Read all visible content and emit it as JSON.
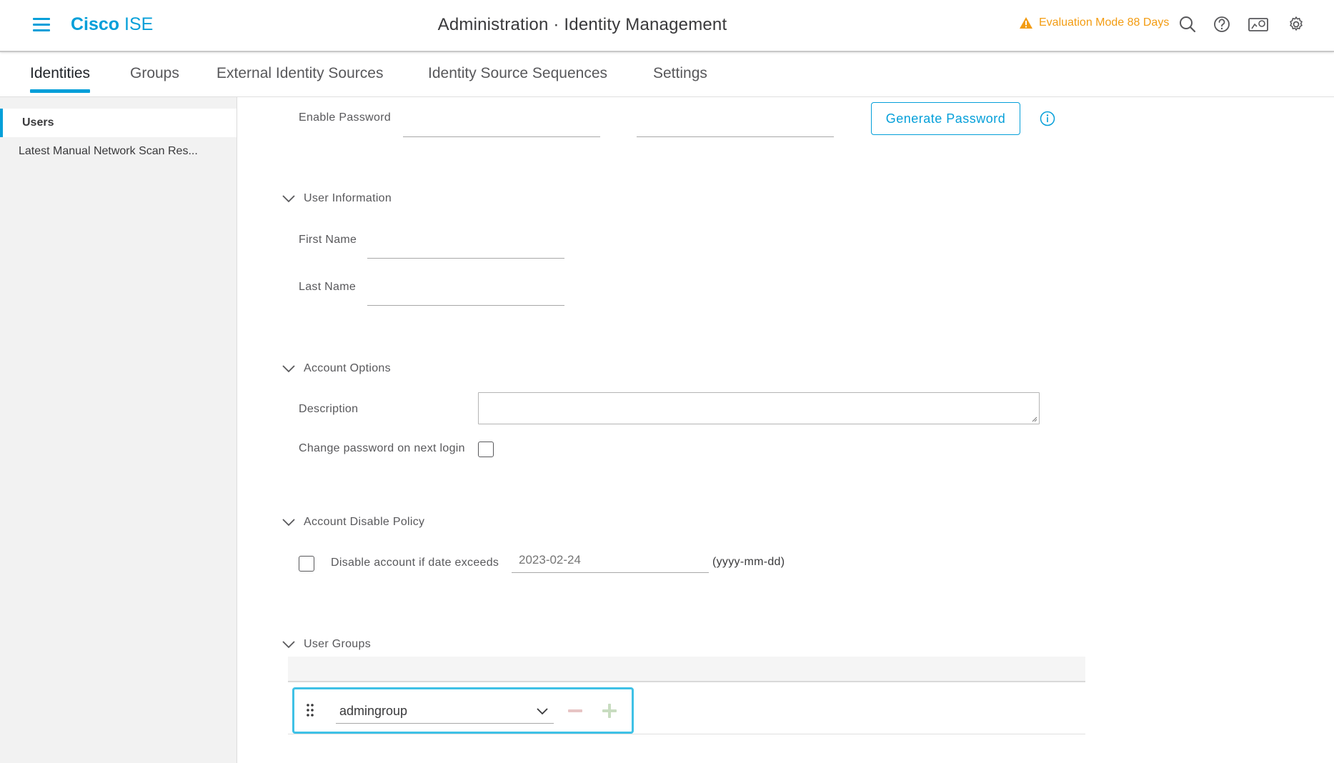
{
  "header": {
    "brand_bold": "Cisco",
    "brand_rest": "ISE",
    "title": "Administration · Identity Management",
    "eval_text": "Evaluation Mode 88 Days",
    "accent_color": "#049fd9",
    "warning_color": "#f39c12",
    "icons": [
      "menu-icon",
      "warning-icon",
      "search-icon",
      "help-icon",
      "dashboard-icon",
      "gear-icon"
    ]
  },
  "tabs": [
    {
      "label": "Identities",
      "active": true
    },
    {
      "label": "Groups"
    },
    {
      "label": "External Identity Sources"
    },
    {
      "label": "Identity Source Sequences"
    },
    {
      "label": "Settings"
    }
  ],
  "sidebar": {
    "items": [
      {
        "label": "Users",
        "active": true
      },
      {
        "label": "Latest Manual Network Scan Res..."
      }
    ]
  },
  "form": {
    "enable_password_label": "Enable Password",
    "generate_password_label": "Generate Password",
    "user_information": {
      "title": "User Information",
      "first_name_label": "First Name",
      "last_name_label": "Last Name"
    },
    "account_options": {
      "title": "Account Options",
      "description_label": "Description",
      "change_password_label": "Change password on next login"
    },
    "account_disable_policy": {
      "title": "Account Disable Policy",
      "disable_label": "Disable account if date exceeds",
      "date_placeholder": "2023-02-24",
      "date_format": "(yyyy-mm-dd)"
    },
    "user_groups": {
      "title": "User Groups",
      "selected_group": "admingroup"
    }
  }
}
